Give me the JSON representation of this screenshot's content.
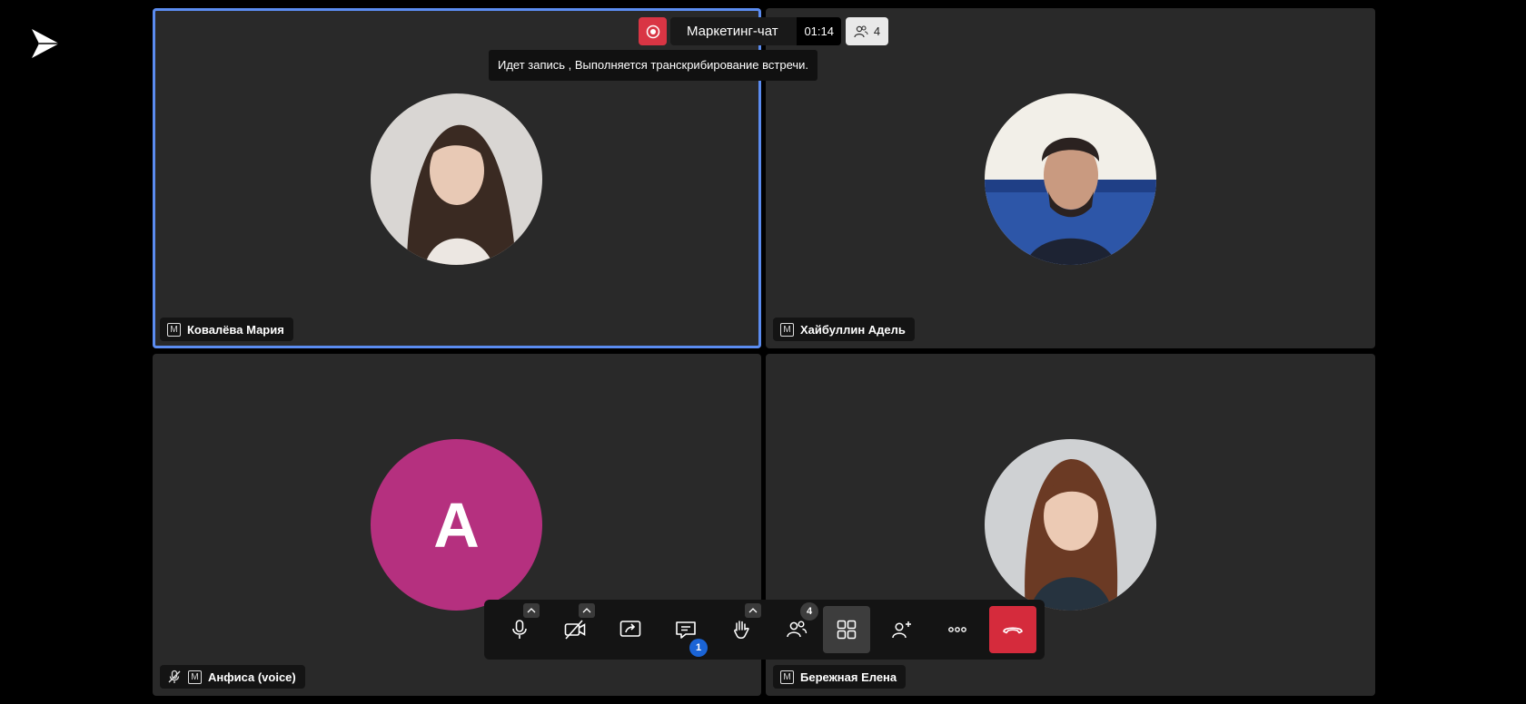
{
  "meeting": {
    "title": "Маркетинг-чат",
    "timer": "01:14",
    "participant_count": "4",
    "recording_tooltip": "Идет запись , Выполняется транскрибирование встречи."
  },
  "participants": [
    {
      "name": "Ковалёва Мария",
      "badge": "M",
      "active": true
    },
    {
      "name": "Хайбуллин Адель",
      "badge": "M",
      "active": false
    },
    {
      "name": "Анфиса (voice)",
      "badge": "M",
      "initial": "A",
      "avatar_color": "#b5307f",
      "muted": true
    },
    {
      "name": "Бережная Елена",
      "badge": "M",
      "active": false
    }
  ],
  "toolbar": {
    "chat_badge": "1",
    "participants_badge": "4",
    "icons": [
      "microphone-icon",
      "camera-off-icon",
      "share-screen-icon",
      "chat-icon",
      "raise-hand-icon",
      "participants-icon",
      "grid-view-icon",
      "add-person-icon",
      "more-icon",
      "hang-up-icon"
    ]
  },
  "colors": {
    "record": "#d93544",
    "end_call": "#d52b3c",
    "active_border": "#5b8cf0",
    "tile_bg": "#292929",
    "chat_badge": "#1a64d6"
  }
}
